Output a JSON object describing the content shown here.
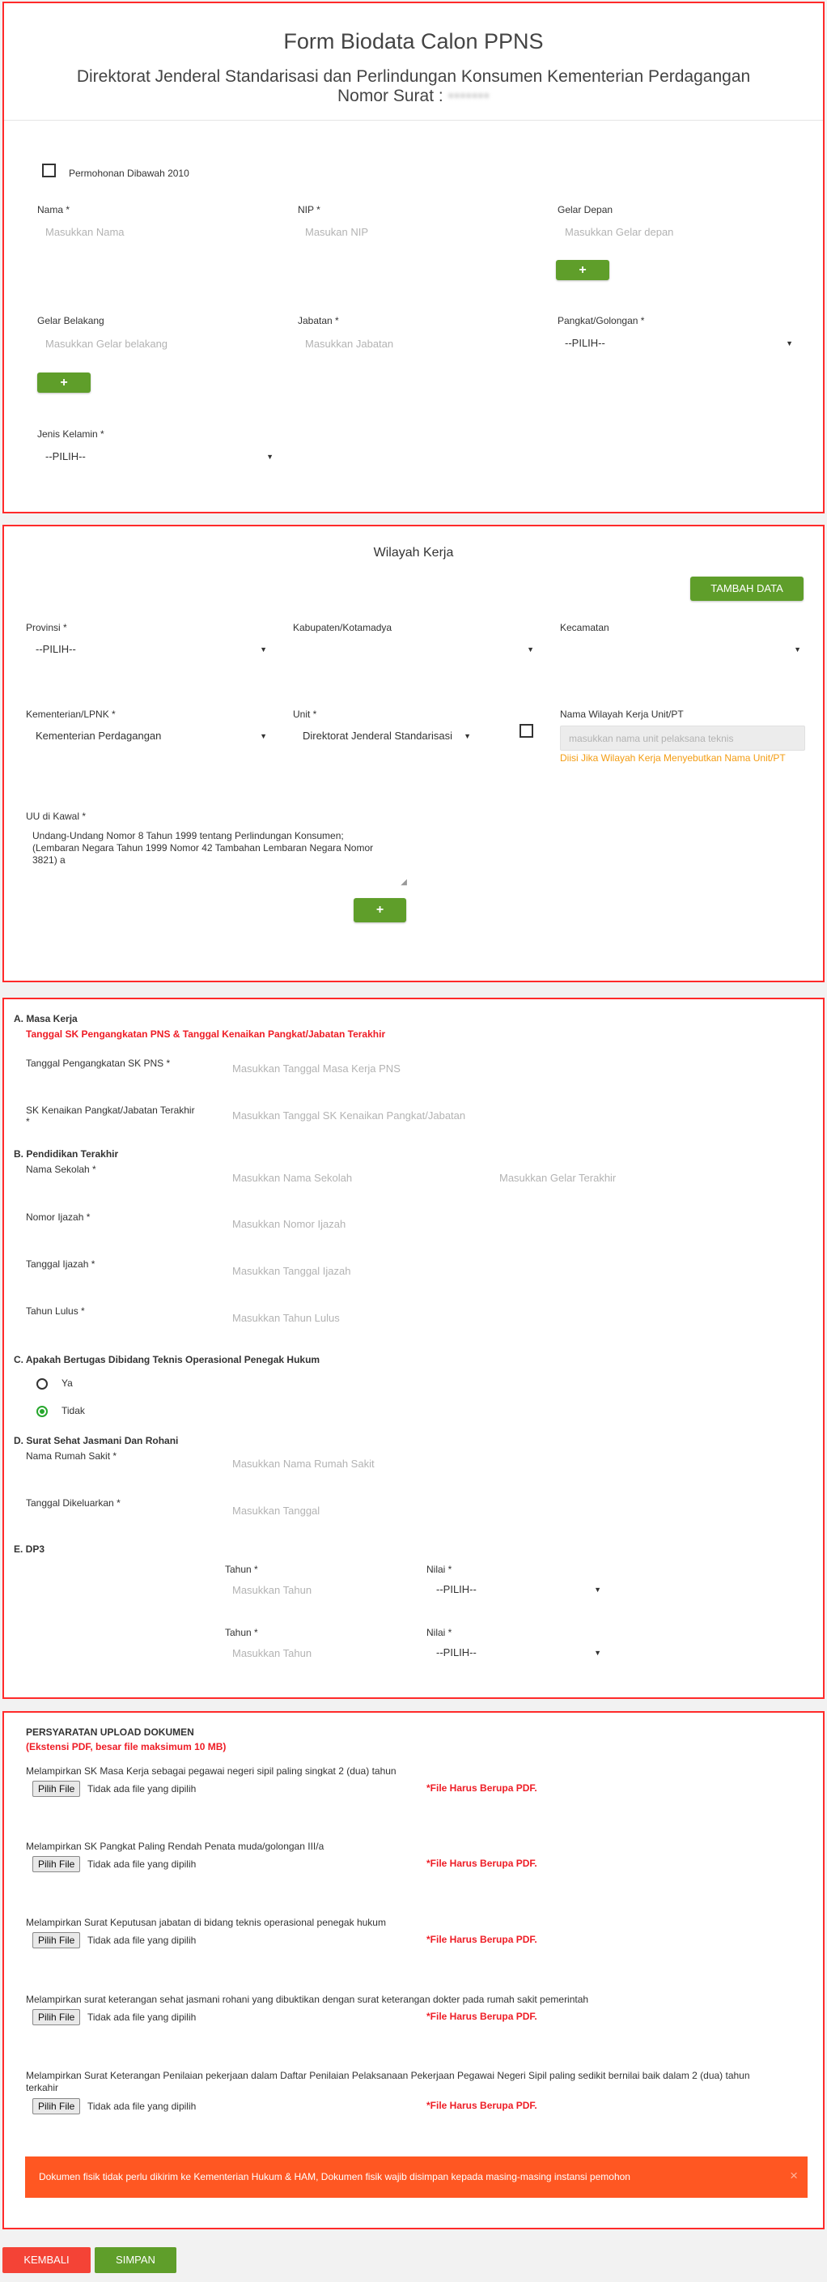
{
  "header": {
    "title": "Form Biodata Calon PPNS",
    "subtitle": "Direktorat Jenderal Standarisasi dan Perlindungan Konsumen Kementerian Perdagangan",
    "nomor_surat_label": "Nomor Surat :",
    "nomor_surat_value": "•••••••"
  },
  "identity": {
    "checkbox_label": "Permohonan Dibawah 2010",
    "nama_label": "Nama *",
    "nama_placeholder": "Masukkan Nama",
    "nip_label": "NIP *",
    "nip_placeholder": "Masukan NIP",
    "gelar_depan_label": "Gelar Depan",
    "gelar_depan_placeholder": "Masukkan Gelar depan",
    "add_label": "+",
    "gelar_belakang_label": "Gelar Belakang",
    "gelar_belakang_placeholder": "Masukkan Gelar belakang",
    "jabatan_label": "Jabatan *",
    "jabatan_placeholder": "Masukkan Jabatan",
    "pangkat_label": "Pangkat/Golongan *",
    "pangkat_value": "--PILIH--",
    "jenis_kelamin_label": "Jenis Kelamin *",
    "jenis_kelamin_value": "--PILIH--",
    "arrow": "▼"
  },
  "wilayah": {
    "title": "Wilayah Kerja",
    "tambah_label": "TAMBAH DATA",
    "provinsi_label": "Provinsi *",
    "provinsi_value": "--PILIH--",
    "kabupaten_label": "Kabupaten/Kotamadya",
    "kecamatan_label": "Kecamatan",
    "kementerian_label": "Kementerian/LPNK *",
    "kementerian_value": "Kementerian Perdagangan",
    "unit_label": "Unit *",
    "unit_value": "Direktorat Jenderal Standarisasi",
    "nama_wilayah_label": "Nama Wilayah Kerja Unit/PT",
    "nama_wilayah_placeholder": "masukkan nama unit pelaksana teknis",
    "nama_wilayah_hint": "Diisi Jika Wilayah Kerja Menyebutkan Nama Unit/PT",
    "uu_label": "UU di Kawal *",
    "uu_line1": "Undang-Undang Nomor 8 Tahun 1999 tentang Perlindungan Konsumen;",
    "uu_line2": "(Lembaran Negara Tahun 1999 Nomor 42 Tambahan Lembaran Negara Nomor",
    "uu_line3": "3821) a",
    "add_label": "+"
  },
  "details": {
    "a_title": "A. Masa Kerja",
    "a_note": "Tanggal SK Pengangkatan PNS & Tanggal Kenaikan Pangkat/Jabatan Terakhir",
    "tgl_pns_label": "Tanggal Pengangkatan SK PNS *",
    "tgl_pns_placeholder": "Masukkan Tanggal Masa Kerja PNS",
    "sk_kenaikan_label": "SK Kenaikan Pangkat/Jabatan Terakhir",
    "sk_kenaikan_star": "*",
    "sk_kenaikan_placeholder": "Masukkan Tanggal SK Kenaikan Pangkat/Jabatan",
    "b_title": "B. Pendidikan Terakhir",
    "sekolah_label": "Nama Sekolah *",
    "sekolah_placeholder": "Masukkan Nama Sekolah",
    "gelar_placeholder": "Masukkan Gelar Terakhir",
    "ijazah_label": "Nomor Ijazah *",
    "ijazah_placeholder": "Masukkan Nomor Ijazah",
    "tgl_ijazah_label": "Tanggal Ijazah *",
    "tgl_ijazah_placeholder": "Masukkan Tanggal Ijazah",
    "tahun_lulus_label": "Tahun Lulus *",
    "tahun_lulus_placeholder": "Masukkan Tahun Lulus",
    "c_title": "C. Apakah Bertugas Dibidang Teknis Operasional Penegak Hukum",
    "ya_label": "Ya",
    "tidak_label": "Tidak",
    "d_title": "D. Surat Sehat Jasmani Dan Rohani",
    "rs_label": "Nama Rumah Sakit *",
    "rs_placeholder": "Masukkan Nama Rumah Sakit",
    "tgl_keluar_label": "Tanggal Dikeluarkan *",
    "tgl_keluar_placeholder": "Masukkan Tanggal",
    "e_title": "E. DP3",
    "tahun_label": "Tahun *",
    "tahun_placeholder": "Masukkan Tahun",
    "nilai_label": "Nilai *",
    "nilai_value": "--PILIH--",
    "arrow": "▼"
  },
  "upload": {
    "title": "PERSYARATAN UPLOAD DOKUMEN",
    "note": "(Ekstensi PDF, besar file maksimum 10 MB)",
    "choose_label": "Pilih File",
    "no_file": "Tidak ada file yang dipilih",
    "pdf_note": "*File Harus Berupa PDF.",
    "items": [
      "Melampirkan SK Masa Kerja sebagai pegawai negeri sipil paling singkat 2 (dua) tahun",
      "Melampirkan SK Pangkat Paling Rendah Penata muda/golongan III/a",
      "Melampirkan Surat Keputusan jabatan di bidang teknis operasional penegak hukum",
      "Melampirkan surat keterangan sehat jasmani rohani yang dibuktikan dengan surat keterangan dokter pada rumah sakit pemerintah",
      "Melampirkan Surat Keterangan Penilaian pekerjaan dalam Daftar Penilaian Pelaksanaan Pekerjaan Pegawai Negeri Sipil paling sedikit bernilai baik dalam 2 (dua) tahun",
      "terkahir"
    ],
    "alert_text": "Dokumen fisik tidak perlu dikirim ke Kementerian Hukum & HAM, Dokumen fisik wajib disimpan kepada masing-masing instansi pemohon",
    "alert_close": "×"
  },
  "footer": {
    "kembali_label": "KEMBALI",
    "simpan_label": "SIMPAN"
  },
  "colors": {
    "border_red": "#ff2a2a",
    "green": "#5f9e2a",
    "alert_orange": "#ff5722",
    "hint_orange": "#f39c12",
    "kembali_red": "#f44336"
  }
}
